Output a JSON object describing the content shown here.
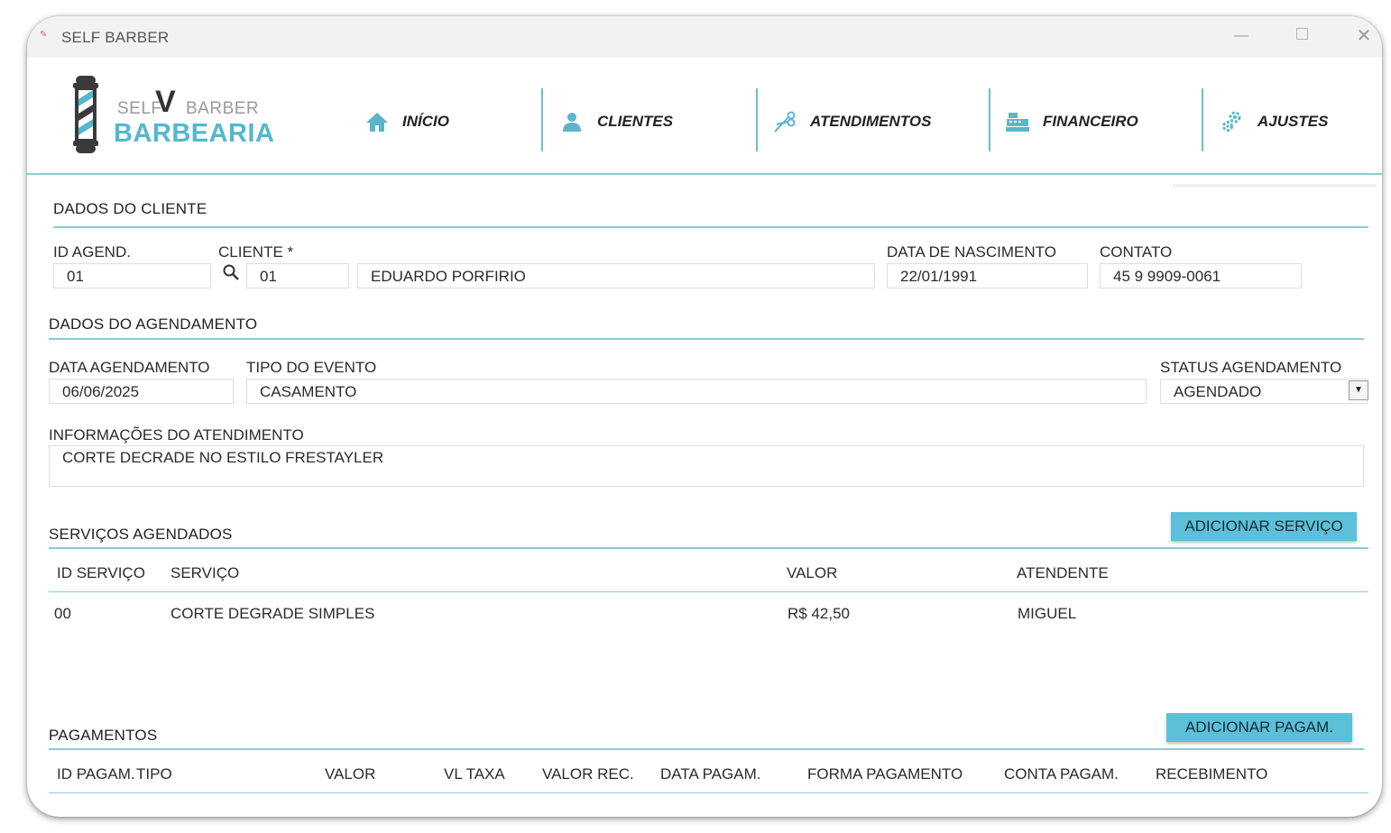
{
  "window": {
    "title": "SELF BARBER",
    "min_glyph": "—",
    "close_glyph": "✕"
  },
  "logo": {
    "line1": "SELF",
    "line1b": "BARBER",
    "line2": "BARBEARIA"
  },
  "nav": [
    {
      "label": "INÍCIO",
      "icon": "home-icon"
    },
    {
      "label": "CLIENTES",
      "icon": "user-icon"
    },
    {
      "label": "ATENDIMENTOS",
      "icon": "scissors-icon"
    },
    {
      "label": "FINANCEIRO",
      "icon": "cash-register-icon"
    },
    {
      "label": "AJUSTES",
      "icon": "gears-icon"
    }
  ],
  "cliente": {
    "section_title": "DADOS DO CLIENTE",
    "id_label": "ID AGEND.",
    "id_value": "01",
    "cliente_label": "CLIENTE *",
    "cliente_id": "01",
    "cliente_nome": "EDUARDO PORFIRIO",
    "nasc_label": "DATA DE NASCIMENTO",
    "nasc_value": "22/01/1991",
    "contato_label": "CONTATO",
    "contato_value": "45 9 9909-0061"
  },
  "agendamento": {
    "section_title": "DADOS DO AGENDAMENTO",
    "data_label": "DATA AGENDAMENTO",
    "data_value": "06/06/2025",
    "tipo_label": "TIPO DO EVENTO",
    "tipo_value": "CASAMENTO",
    "status_label": "STATUS AGENDAMENTO",
    "status_value": "AGENDADO",
    "info_label": "INFORMAÇÕES DO ATENDIMENTO",
    "info_value": "CORTE DECRADE NO ESTILO FRESTAYLER"
  },
  "servicos": {
    "section_title": "SERVIÇOS AGENDADOS",
    "add_button": "ADICIONAR SERVIÇO",
    "headers": [
      "ID SERVIÇO",
      "SERVIÇO",
      "VALOR",
      "ATENDENTE"
    ],
    "rows": [
      [
        "00",
        "CORTE DEGRADE SIMPLES",
        "R$ 42,50",
        "MIGUEL"
      ]
    ]
  },
  "pagamentos": {
    "section_title": "PAGAMENTOS",
    "add_button": "ADICIONAR PAGAM.",
    "headers": [
      "ID PAGAM.",
      "TIPO",
      "VALOR",
      "VL TAXA",
      "VALOR REC.",
      "DATA PAGAM.",
      "FORMA PAGAMENTO",
      "CONTA PAGAM.",
      "RECEBIMENTO"
    ]
  },
  "colors": {
    "accent": "#5bc0d8",
    "line": "#8ccbd6",
    "logo_blue": "#55b7cf"
  }
}
